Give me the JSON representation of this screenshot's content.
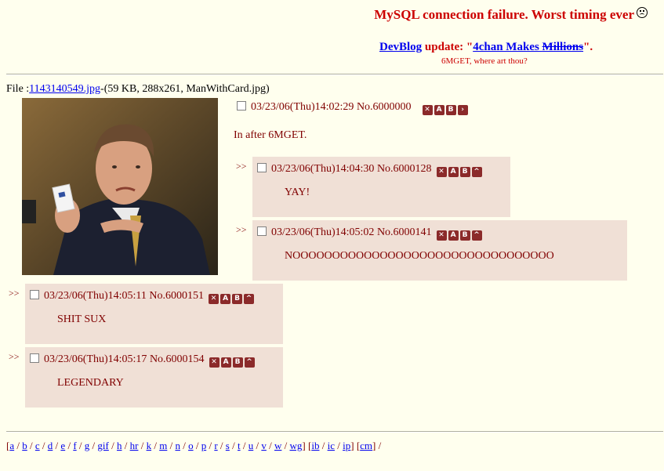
{
  "header": {
    "title": "MySQL connection failure. Worst timing ever",
    "title_icon": "frown-smiley-icon",
    "devblog_link": "DevBlog",
    "devblog_mid": " update: \"",
    "devblog_post_link": "4chan Makes ",
    "devblog_strike": "Millions",
    "devblog_end": "\".",
    "subtag": "6MGET, where art thou?"
  },
  "op": {
    "file_prefix": "File :",
    "file_link": "1143140549.jpg",
    "file_meta": "-(59 KB, 288x261, ManWithCard.jpg)",
    "datetime": "03/23/06(Thu)14:02:29",
    "post_no": "No.6000000",
    "comment": "In after 6MGET."
  },
  "replies": [
    {
      "datetime": "03/23/06(Thu)14:04:30",
      "post_no": "No.6000128",
      "comment": "YAY!"
    },
    {
      "datetime": "03/23/06(Thu)14:05:02",
      "post_no": "No.6000141",
      "comment": "NOOOOOOOOOOOOOOOOOOOOOOOOOOOOOOOOO"
    },
    {
      "datetime": "03/23/06(Thu)14:05:11",
      "post_no": "No.6000151",
      "comment": "SHIT SUX"
    },
    {
      "datetime": "03/23/06(Thu)14:05:17",
      "post_no": "No.6000154",
      "comment": "LEGENDARY"
    }
  ],
  "reply_marker": ">>",
  "post_buttons": [
    "delete-icon",
    "report-icon",
    "edit-icon",
    "quote-icon"
  ],
  "board_nav": {
    "groups": [
      [
        "a",
        "b",
        "c",
        "d",
        "e",
        "f",
        "g",
        "gif",
        "h",
        "hr",
        "k",
        "m",
        "n",
        "o",
        "p",
        "r",
        "s",
        "t",
        "u",
        "v",
        "w",
        "wg"
      ],
      [
        "ib",
        "ic",
        "ip"
      ],
      [
        "cm"
      ]
    ],
    "trailing": " /"
  },
  "colors": {
    "background": "#FFFFEE",
    "reply_bg": "#F0E0D6",
    "text": "#800000",
    "headline": "#CC0000",
    "link": "#0000EE"
  }
}
